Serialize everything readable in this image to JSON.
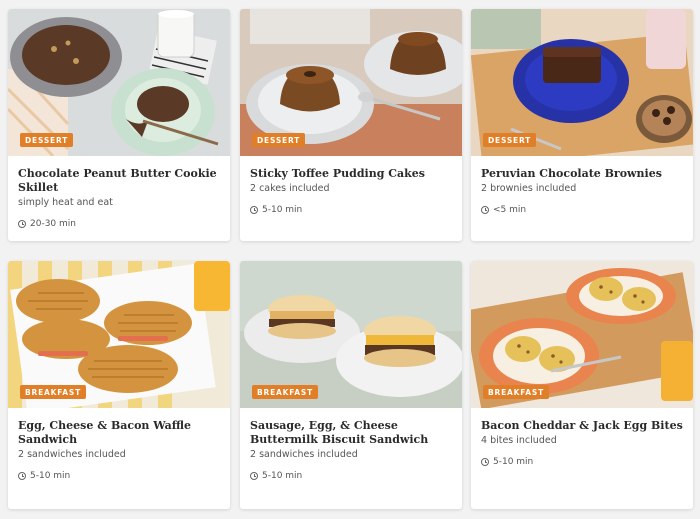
{
  "colors": {
    "badge": "#e07f27",
    "page_background": "#f2f2f2",
    "card_background": "#ffffff"
  },
  "cards": [
    {
      "category": "DESSERT",
      "title": "Chocolate Peanut Butter Cookie Skillet",
      "subtitle": "simply heat and eat",
      "time": "20-30 min",
      "icon": "clock-icon"
    },
    {
      "category": "DESSERT",
      "title": "Sticky Toffee Pudding Cakes",
      "subtitle": "2 cakes included",
      "time": "5-10 min",
      "icon": "clock-icon"
    },
    {
      "category": "DESSERT",
      "title": "Peruvian Chocolate Brownies",
      "subtitle": "2 brownies included",
      "time": "<5 min",
      "icon": "clock-icon"
    },
    {
      "category": "BREAKFAST",
      "title": "Egg, Cheese & Bacon Waffle Sandwich",
      "subtitle": "2 sandwiches included",
      "time": "5-10 min",
      "icon": "clock-icon"
    },
    {
      "category": "BREAKFAST",
      "title": "Sausage, Egg, & Cheese Buttermilk Biscuit Sandwich",
      "subtitle": "2 sandwiches included",
      "time": "5-10 min",
      "icon": "clock-icon"
    },
    {
      "category": "BREAKFAST",
      "title": "Bacon Cheddar & Jack Egg Bites",
      "subtitle": "4 bites included",
      "time": "5-10 min",
      "icon": "clock-icon"
    }
  ]
}
